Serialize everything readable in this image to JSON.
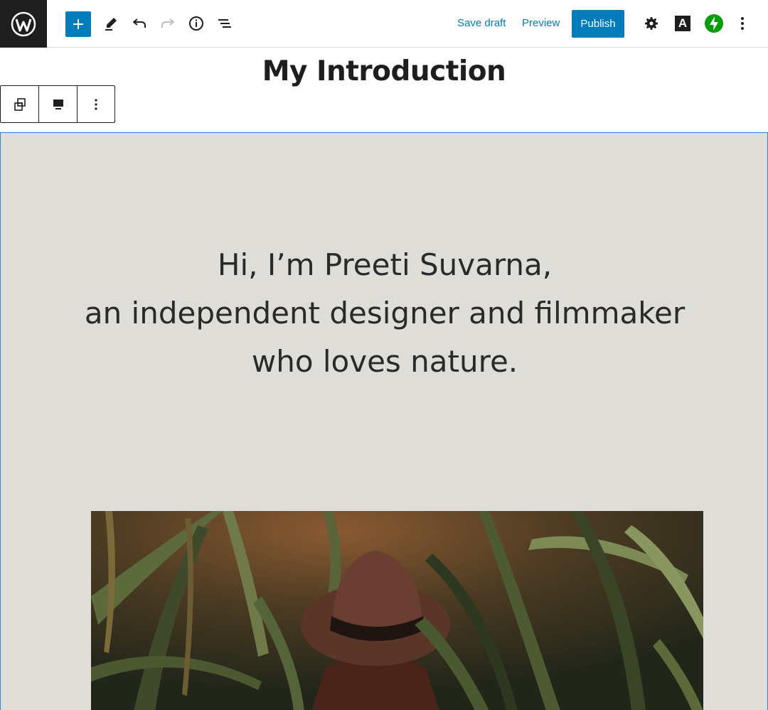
{
  "toolbar": {
    "save_draft_label": "Save draft",
    "preview_label": "Preview",
    "publish_label": "Publish",
    "typography_letter": "A"
  },
  "post": {
    "title": "My Introduction"
  },
  "cover": {
    "lines": [
      "Hi, I’m Preeti Suvarna,",
      "an independent designer and filmmaker",
      "who loves nature."
    ]
  },
  "colors": {
    "accent": "#007cba",
    "cover_background": "#dfddd7",
    "jetpack_green": "#069e08"
  }
}
